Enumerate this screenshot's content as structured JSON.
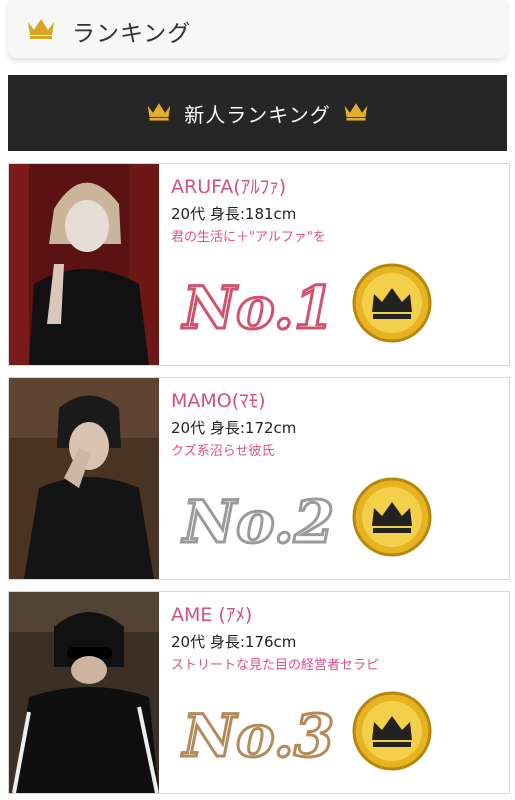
{
  "header": {
    "title": "ランキング"
  },
  "banner": {
    "title": "新人ランキング"
  },
  "casts": [
    {
      "name": "ARUFA(ｱﾙﾌｧ)",
      "spec": "20代 身長:181cm",
      "catch": "君の生活に＋\"アルファ\"を",
      "rank_label": "No.1"
    },
    {
      "name": "MAMO(ﾏﾓ)",
      "spec": "20代 身長:172cm",
      "catch": "クズ系沼らせ彼氏",
      "rank_label": "No.2"
    },
    {
      "name": "AME (ｱﾒ)",
      "spec": "20代 身長:176cm",
      "catch": "ストリートな見た目の経営者セラピ",
      "rank_label": "No.3"
    }
  ],
  "colors": {
    "accent_pink": "#d2527a",
    "gold": "#d9a520",
    "banner_bg": "#262626",
    "rank1": "#d2526e",
    "rank2": "#b7b7b7",
    "rank3": "#b58a5a"
  }
}
